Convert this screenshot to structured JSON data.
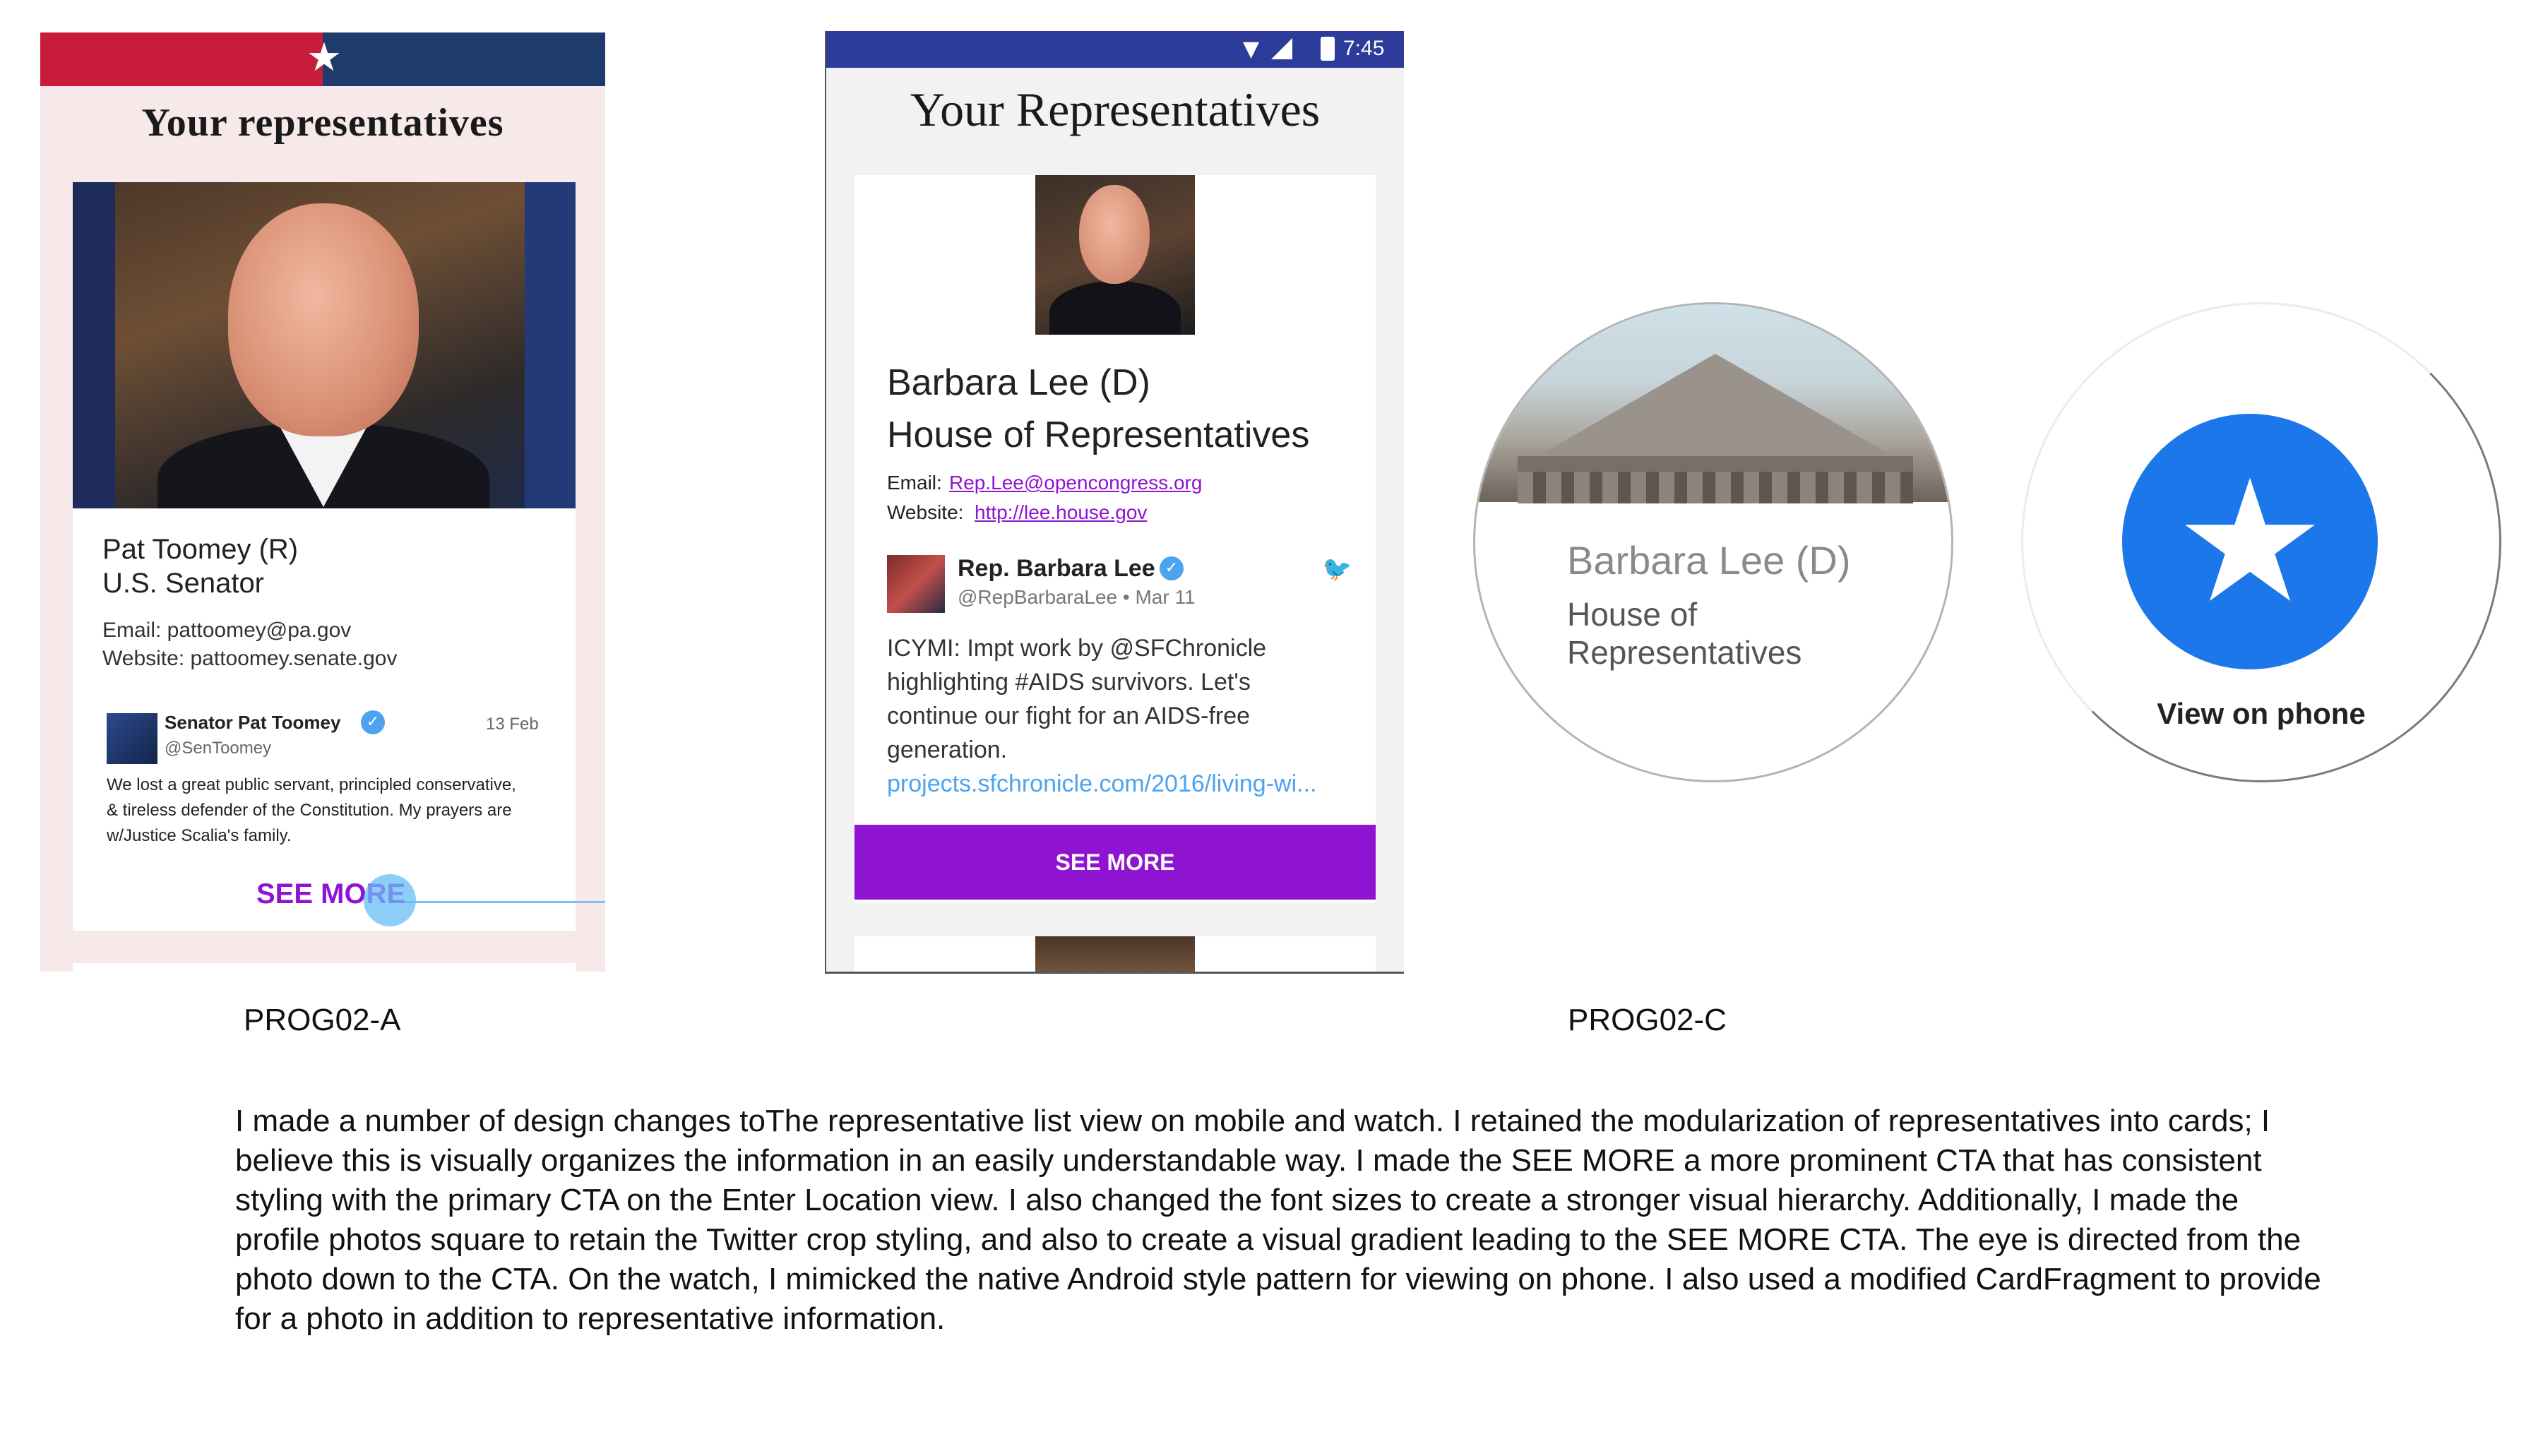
{
  "panel_a": {
    "title": "Your representatives",
    "name": "Pat Toomey (R)",
    "role": "U.S. Senator",
    "email": "Email: pattoomey@pa.gov",
    "website": "Website: pattoomey.senate.gov",
    "tweet": {
      "display_name": "Senator Pat Toomey",
      "handle": "@SenToomey",
      "date": "13 Feb",
      "text": "We lost a great public servant, principled conservative, & tireless defender of the Constitution. My prayers are w/Justice Scalia's family."
    },
    "see_more": "SEE MORE",
    "colors": {
      "flag_red": "#c81d3a",
      "flag_blue": "#1f3b6b",
      "background": "#f7e9e9",
      "cta": "#8f14d1"
    }
  },
  "panel_b": {
    "status_time": "7:45",
    "title": "Your Representatives",
    "name": "Barbara Lee (D)",
    "role": "House of Representatives",
    "email_label": "Email:",
    "email": "Rep.Lee@opencongress.org",
    "website_label": "Website:",
    "website": "http://lee.house.gov",
    "tweet": {
      "display_name": "Rep. Barbara Lee",
      "handle_date": "@RepBarbaraLee • Mar 11",
      "text": "ICYMI: Impt work by @SFChronicle highlighting #AIDS survivors. Let's continue our fight for an AIDS-free generation.",
      "link": "projects.sfchronicle.com/2016/living-wi..."
    },
    "see_more": "SEE MORE",
    "icons": [
      "wifi-icon",
      "signal-icon",
      "battery-icon",
      "verified-icon",
      "twitter-bird-icon"
    ],
    "colors": {
      "status_bar": "#2d3c9b",
      "cta": "#8f14d1",
      "link": "#8f14d1",
      "twitter": "#4da3ef"
    }
  },
  "watch_1": {
    "name": "Barbara Lee (D)",
    "role_line1": "House of",
    "role_line2": "Representatives"
  },
  "watch_2": {
    "label": "View on phone",
    "icon": "star-icon",
    "colors": {
      "button": "#1c78ea"
    }
  },
  "captions": {
    "left": "PROG02-A",
    "right": "PROG02-C"
  },
  "description": "I made a number of design changes toThe representative list view on mobile and watch. I retained the modularization of representatives into cards; I believe this is visually organizes the information in an easily understandable way. I made the SEE MORE a more prominent CTA that has consistent styling with the primary CTA on the Enter Location view. I also changed the font sizes to create a stronger visual hierarchy. Additionally, I made the profile photos square to retain the Twitter crop styling, and also to create a visual gradient leading to the SEE MORE CTA. The eye is directed from the photo down to the CTA. On the watch, I mimicked the native Android style pattern for viewing on phone. I also used a modified CardFragment to provide for a photo in addition to representative information."
}
